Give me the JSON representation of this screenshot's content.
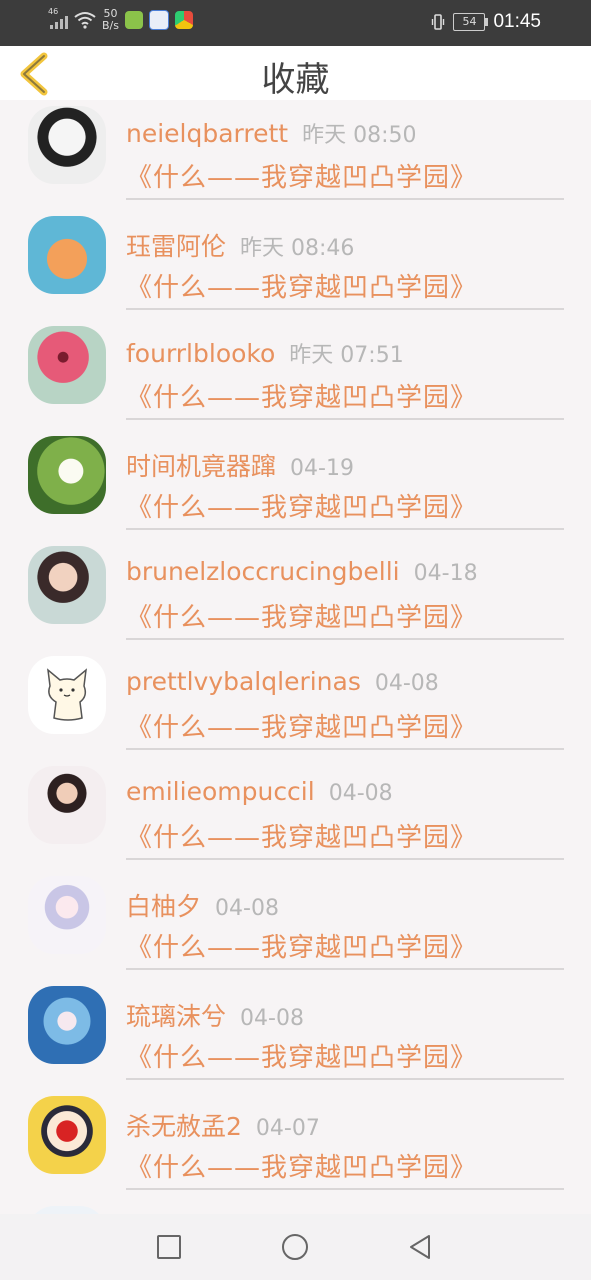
{
  "status_bar": {
    "network": "46",
    "speed_value": "50",
    "speed_unit": "B/s",
    "battery": "54",
    "time": "01:45"
  },
  "header": {
    "title": "收藏",
    "back_icon": "chevron-left-icon",
    "accent_color": "#f2c53d"
  },
  "favorites": [
    {
      "name": "neielqbarrett",
      "time": "昨天 08:50",
      "book": "《什么——我穿越凹凸学园》"
    },
    {
      "name": "珏雷阿伦",
      "time": "昨天 08:46",
      "book": "《什么——我穿越凹凸学园》"
    },
    {
      "name": "fourrlblooko",
      "time": "昨天 07:51",
      "book": "《什么——我穿越凹凸学园》"
    },
    {
      "name": "时间机竟器蹿",
      "time": "04-19",
      "book": "《什么——我穿越凹凸学园》"
    },
    {
      "name": "brunelzloccrucingbelli",
      "time": "04-18",
      "book": "《什么——我穿越凹凸学园》"
    },
    {
      "name": "prettlvybalqlerinas",
      "time": "04-08",
      "book": "《什么——我穿越凹凸学园》"
    },
    {
      "name": "emilieompuccil",
      "time": "04-08",
      "book": "《什么——我穿越凹凸学园》"
    },
    {
      "name": "白柚夕",
      "time": "04-08",
      "book": "《什么——我穿越凹凸学园》"
    },
    {
      "name": "琉璃沫兮",
      "time": "04-08",
      "book": "《什么——我穿越凹凸学园》"
    },
    {
      "name": "杀无赦孟2",
      "time": "04-07",
      "book": "《什么——我穿越凹凸学园》"
    }
  ],
  "colors": {
    "name_text": "#e8915e",
    "time_text": "#b7b7b7",
    "background": "#f7f4f5"
  },
  "nav": {
    "recent_icon": "square-icon",
    "home_icon": "circle-icon",
    "back_icon": "triangle-back-icon"
  }
}
